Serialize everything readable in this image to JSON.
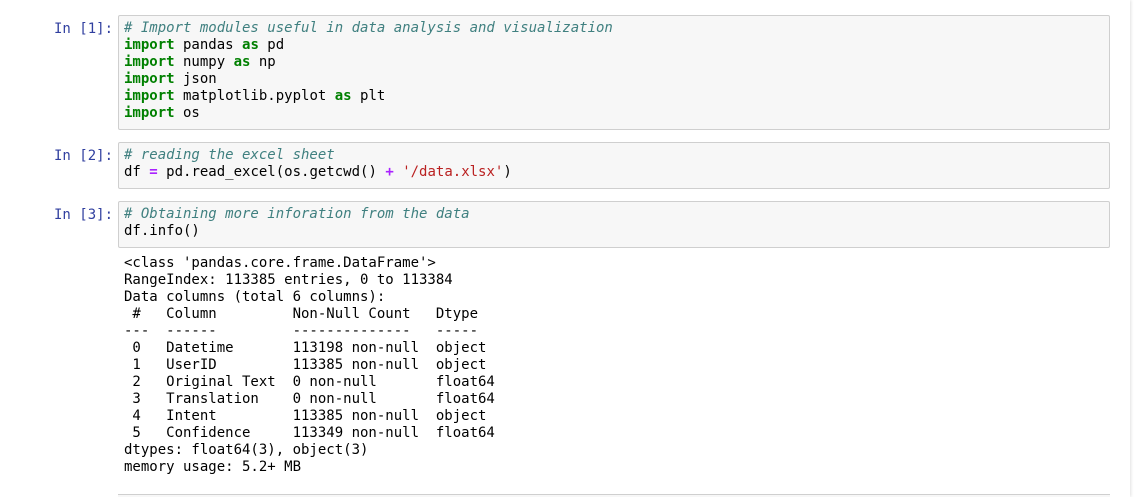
{
  "cells": [
    {
      "prompt": "In [1]:",
      "code": [
        [
          {
            "t": "# Import modules useful in data analysis and visualization",
            "c": "cm"
          }
        ],
        [
          {
            "t": "import",
            "c": "kw"
          },
          {
            "t": " pandas ",
            "c": ""
          },
          {
            "t": "as",
            "c": "kw"
          },
          {
            "t": " pd",
            "c": ""
          }
        ],
        [
          {
            "t": "import",
            "c": "kw"
          },
          {
            "t": " numpy ",
            "c": ""
          },
          {
            "t": "as",
            "c": "kw"
          },
          {
            "t": " np",
            "c": ""
          }
        ],
        [
          {
            "t": "import",
            "c": "kw"
          },
          {
            "t": " json",
            "c": ""
          }
        ],
        [
          {
            "t": "import",
            "c": "kw"
          },
          {
            "t": " matplotlib.pyplot ",
            "c": ""
          },
          {
            "t": "as",
            "c": "kw"
          },
          {
            "t": " plt",
            "c": ""
          }
        ],
        [
          {
            "t": "import",
            "c": "kw"
          },
          {
            "t": " os",
            "c": ""
          }
        ]
      ],
      "output": []
    },
    {
      "prompt": "In [2]:",
      "code": [
        [
          {
            "t": "# reading the excel sheet",
            "c": "cm"
          }
        ],
        [
          {
            "t": "df ",
            "c": ""
          },
          {
            "t": "=",
            "c": "op"
          },
          {
            "t": " pd.read_excel(os.getcwd() ",
            "c": ""
          },
          {
            "t": "+",
            "c": "op"
          },
          {
            "t": " ",
            "c": ""
          },
          {
            "t": "'/data.xlsx'",
            "c": "st"
          },
          {
            "t": ")",
            "c": ""
          }
        ]
      ],
      "output": []
    },
    {
      "prompt": "In [3]:",
      "code": [
        [
          {
            "t": "# Obtaining more inforation from the data",
            "c": "cm"
          }
        ],
        [
          {
            "t": "df.info()",
            "c": ""
          }
        ]
      ],
      "output": [
        "<class 'pandas.core.frame.DataFrame'>",
        "RangeIndex: 113385 entries, 0 to 113384",
        "Data columns (total 6 columns):",
        " #   Column         Non-Null Count   Dtype  ",
        "---  ------         --------------   -----  ",
        " 0   Datetime       113198 non-null  object ",
        " 1   UserID         113385 non-null  object ",
        " 2   Original Text  0 non-null       float64",
        " 3   Translation    0 non-null       float64",
        " 4   Intent         113385 non-null  object ",
        " 5   Confidence     113349 non-null  float64",
        "dtypes: float64(3), object(3)",
        "memory usage: 5.2+ MB"
      ]
    }
  ]
}
